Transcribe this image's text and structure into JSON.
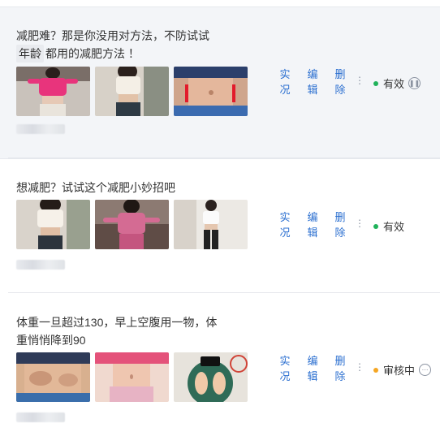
{
  "items": [
    {
      "title_line1": "减肥难？那是你没用对方法，不防试试",
      "title_tag": "年龄",
      "title_line2_rest": "都用的减肥方法 ！",
      "actions": [
        "实况",
        "编辑",
        "删除"
      ],
      "more_icon": "vertical-ellipsis",
      "status": "有效",
      "status_color": "#20b25a",
      "status_icon": "pause-icon"
    },
    {
      "title_line1": "想减肥？试试这个减肥小妙招吧",
      "actions": [
        "实况",
        "编辑",
        "删除"
      ],
      "more_icon": "vertical-ellipsis",
      "status": "有效",
      "status_color": "#20b25a"
    },
    {
      "title_line1": "体重一旦超过130，早上空腹用一物，体",
      "title_line2": "重悄悄降到90",
      "actions": [
        "实况",
        "编辑",
        "删除"
      ],
      "more_icon": "vertical-ellipsis",
      "status": "审核中",
      "status_color": "#f5a623",
      "status_icon": "more-horizontal-icon"
    }
  ]
}
